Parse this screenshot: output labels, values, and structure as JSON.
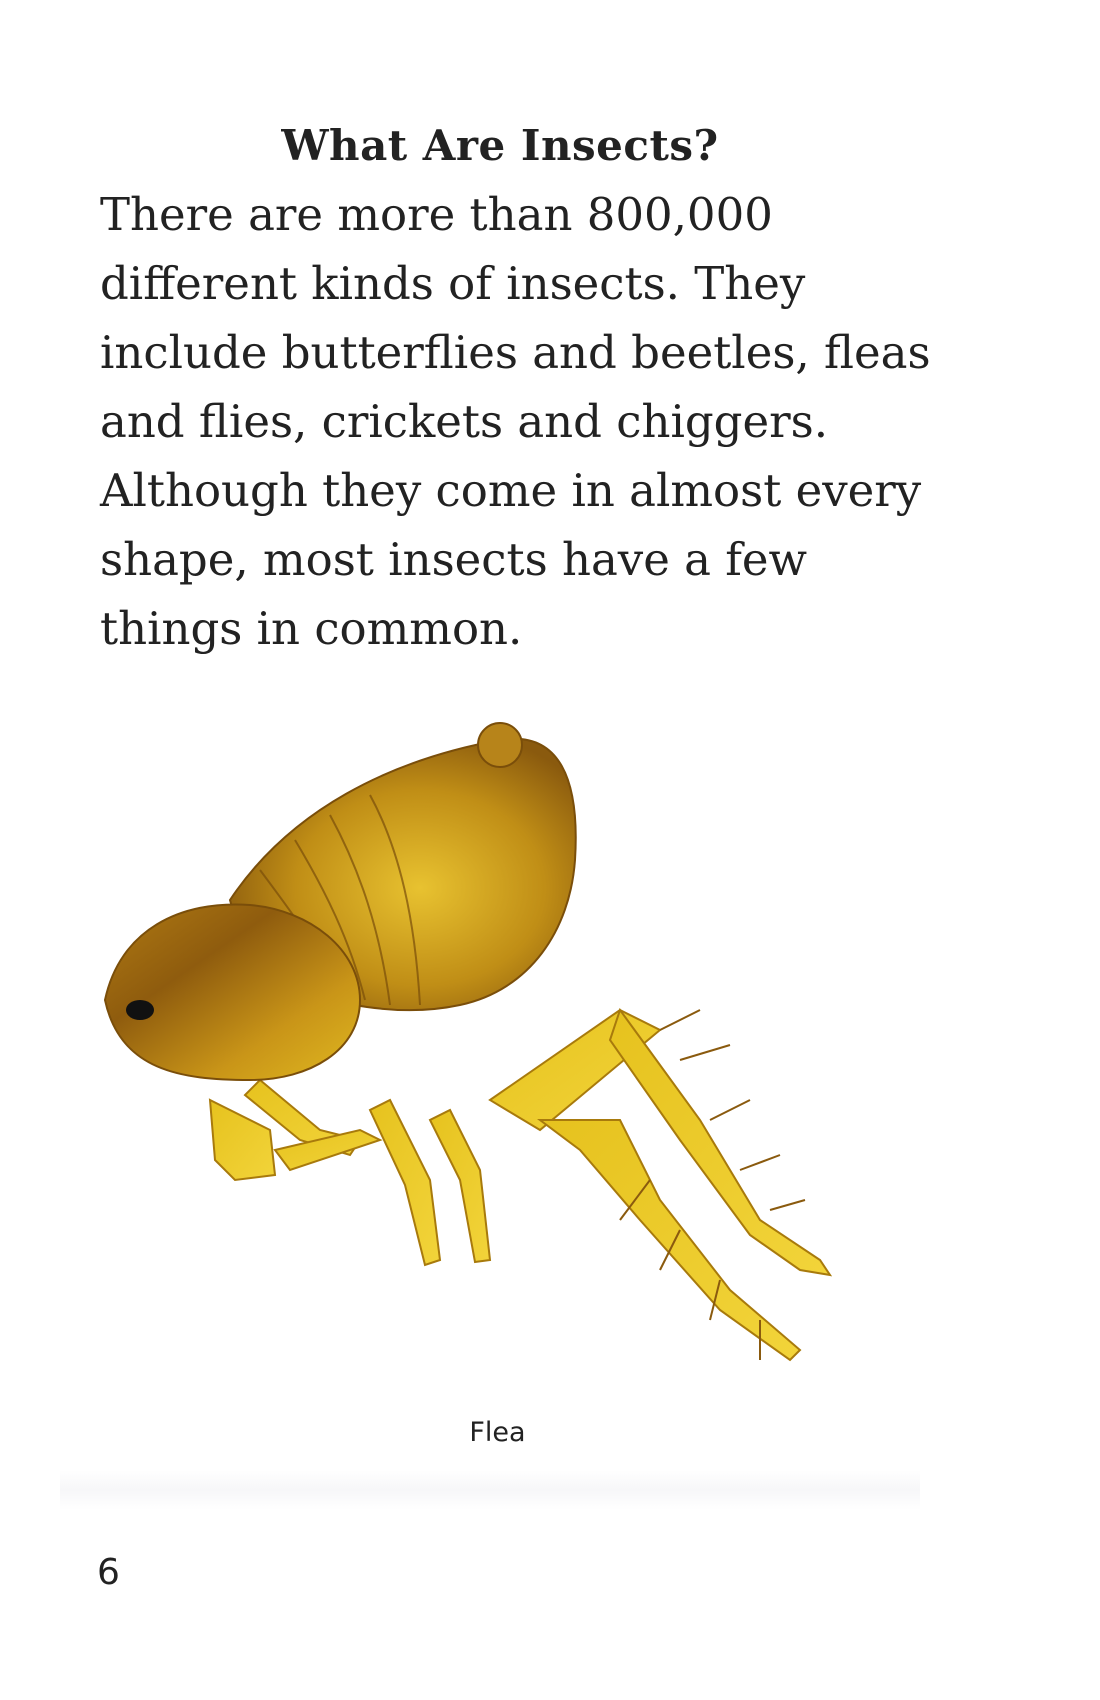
{
  "page": {
    "title": "What Are Insects?",
    "body_lines": [
      "There are more than 800,000",
      "different kinds of insects. They",
      "include butterflies and beetles, fleas",
      "and flies, crickets and chiggers.",
      "Although they come in almost every",
      "shape, most insects have a few",
      "things in common."
    ],
    "image": {
      "subject": "flea-illustration",
      "caption": "Flea"
    },
    "page_number": "6"
  },
  "colors": {
    "text": "#222222",
    "flea_dark": "#8a5a10",
    "flea_mid": "#c89a18",
    "flea_light": "#e8c820"
  }
}
